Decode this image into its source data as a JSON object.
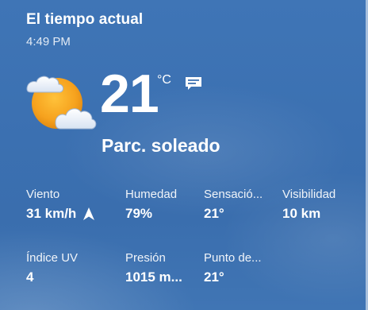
{
  "header": {
    "title": "El tiempo actual",
    "time": "4:49 PM"
  },
  "current": {
    "temperature": "21",
    "unit": "°C",
    "condition": "Parc. soleado",
    "weather_icon": "partly-sunny-icon",
    "note_icon": "message-icon"
  },
  "metrics": [
    {
      "label": "Viento",
      "value": "31 km/h",
      "icon": "wind-direction-arrow-icon"
    },
    {
      "label": "Humedad",
      "value": "79%"
    },
    {
      "label": "Sensació...",
      "value": "21°"
    },
    {
      "label": "Visibilidad",
      "value": "10 km"
    },
    {
      "label": "Índice UV",
      "value": "4"
    },
    {
      "label": "Presión",
      "value": "1015 m..."
    },
    {
      "label": "Punto de...",
      "value": "21°"
    }
  ],
  "colors": {
    "background": "#3b70b1",
    "sun": "#f6a21e",
    "text": "#ffffff"
  }
}
